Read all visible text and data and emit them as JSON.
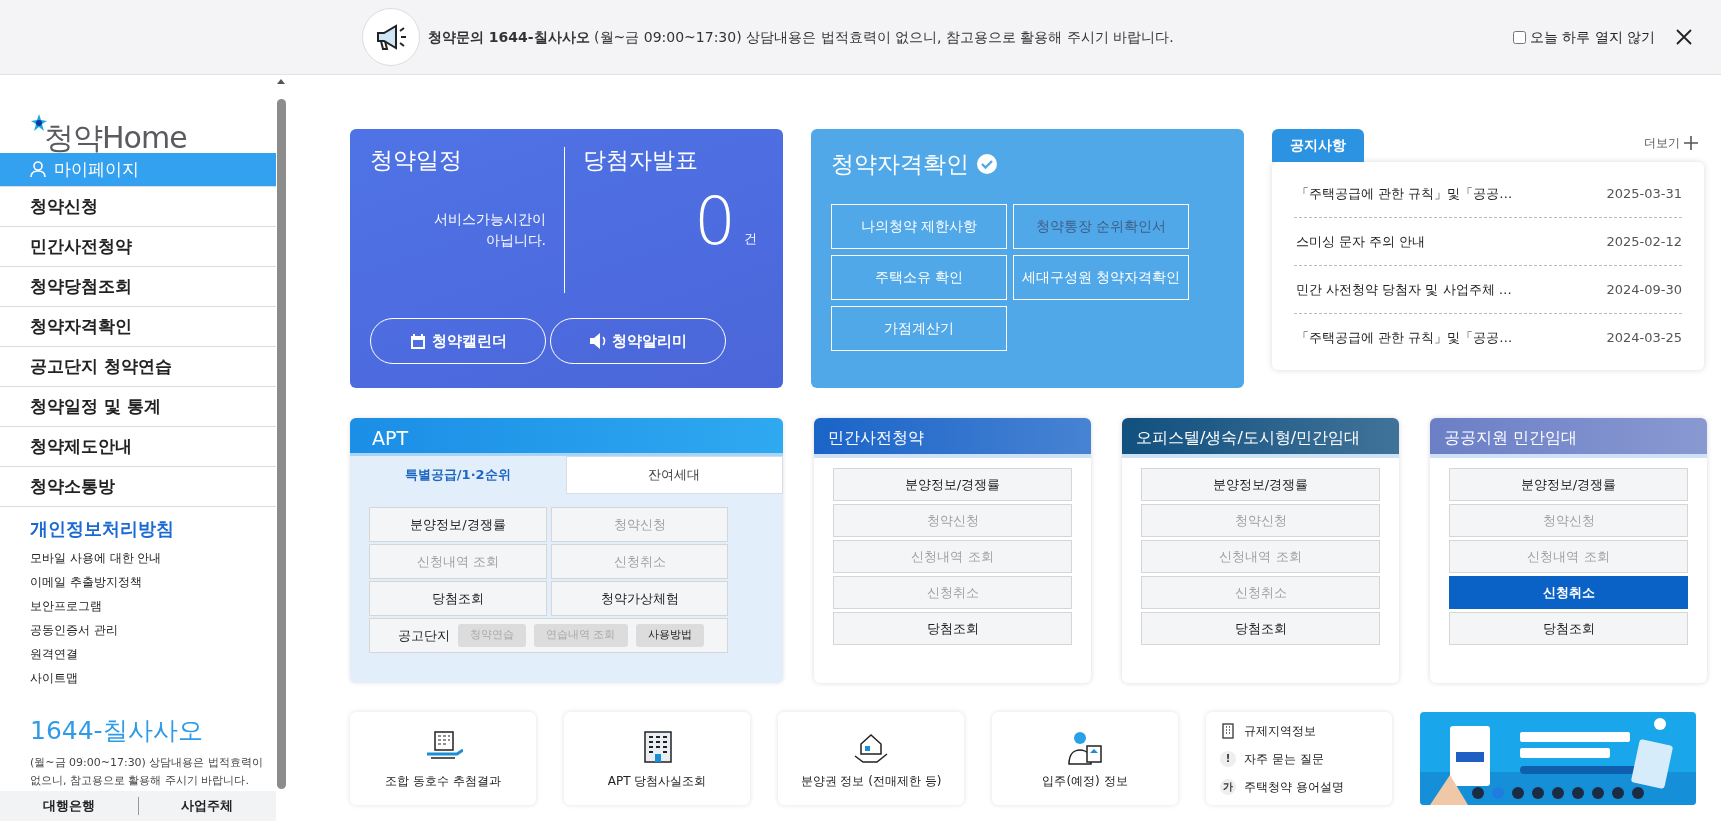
{
  "top_notice": {
    "text": "**청약문의 1644-칠사사오** (월~금 09:00~17:30) 상담내용은 법적효력이 없으니, 참고용으로 활용해 주시기 바랍니다.",
    "dismiss_label": "오늘 하루 열지 않기",
    "dismiss_checked": false
  },
  "sidebar": {
    "logo": "청약Home",
    "menu": [
      {
        "label": "마이페이지",
        "selected": true
      },
      {
        "label": "청약신청",
        "selected": false
      },
      {
        "label": "민간사전청약",
        "selected": false
      },
      {
        "label": "청약당첨조회",
        "selected": false
      },
      {
        "label": "청약자격확인",
        "selected": false
      },
      {
        "label": "공고단지 청약연습",
        "selected": false
      },
      {
        "label": "청약일정 및 통계",
        "selected": false
      },
      {
        "label": "청약제도안내",
        "selected": false
      },
      {
        "label": "청약소통방",
        "selected": false
      }
    ],
    "policy_title": "개인정보처리방침",
    "links": [
      "모바일 사용에 대한 안내",
      "이메일 추출방지정책",
      "보안프로그램",
      "공동인증서 관리",
      "원격연결",
      "사이트맵"
    ],
    "phone": "1644-칠사사오",
    "phone_note": "(월~금 09:00~17:30) 상담내용은 법적효력이 없으니, 참고용으로 활용해 주시기 바랍니다.",
    "footer_tabs": [
      "대행은행",
      "사업주체"
    ]
  },
  "schedule_card": {
    "title": "청약일정",
    "message": "서비스가능시간이 아닙니다.",
    "winner_title": "당첨자발표",
    "count": "0",
    "unit": "건",
    "buttons": [
      {
        "label": "청약캘린더",
        "kind": "calendar"
      },
      {
        "label": "청약알리미",
        "kind": "speaker"
      }
    ]
  },
  "eligibility_card": {
    "title": "청약자격확인",
    "buttons": [
      {
        "label": "나의청약 제한사항",
        "disabled": false
      },
      {
        "label": "청약통장 순위확인서",
        "disabled": true
      },
      {
        "label": "주택소유 확인",
        "disabled": false
      },
      {
        "label": "세대구성원 청약자격확인",
        "disabled": false
      },
      {
        "label": "가점계산기",
        "disabled": false
      }
    ]
  },
  "notices": {
    "title": "공지사항",
    "more": "더보기",
    "items": [
      {
        "title": "「주택공급에 관한 규칙」및「공공…",
        "date": "2025-03-31"
      },
      {
        "title": "스미싱 문자 주의 안내",
        "date": "2025-02-12"
      },
      {
        "title": "민간 사전청약 당첨자 및 사업주체 …",
        "date": "2024-09-30"
      },
      {
        "title": "「주택공급에 관한 규칙」및「공공…",
        "date": "2024-03-25"
      }
    ]
  },
  "apt": {
    "title": "APT",
    "tabs": [
      {
        "label": "특별공급/1·2순위",
        "selected": true
      },
      {
        "label": "잔여세대",
        "selected": false
      }
    ],
    "buttons": [
      {
        "label": "분양정보/경쟁률",
        "disabled": false
      },
      {
        "label": "청약신청",
        "disabled": true
      },
      {
        "label": "신청내역 조회",
        "disabled": true
      },
      {
        "label": "신청취소",
        "disabled": true
      },
      {
        "label": "당첨조회",
        "disabled": false
      },
      {
        "label": "청약가상체험",
        "disabled": false
      }
    ],
    "practice_label": "공고단지",
    "practice_buttons": [
      {
        "label": "청약연습",
        "disabled": true
      },
      {
        "label": "연습내역 조회",
        "disabled": true
      },
      {
        "label": "사용방법",
        "disabled": false
      }
    ]
  },
  "boxes": [
    {
      "title": "민간사전청약",
      "color": "#1a64c8",
      "buttons": [
        {
          "label": "분양정보/경쟁률",
          "disabled": false,
          "selected": false
        },
        {
          "label": "청약신청",
          "disabled": true,
          "selected": false
        },
        {
          "label": "신청내역 조회",
          "disabled": true,
          "selected": false
        },
        {
          "label": "신청취소",
          "disabled": true,
          "selected": false
        },
        {
          "label": "당첨조회",
          "disabled": false,
          "selected": false
        }
      ]
    },
    {
      "title": "오피스텔/생숙/도시형/민간임대",
      "color": "#11507f",
      "buttons": [
        {
          "label": "분양정보/경쟁률",
          "disabled": false,
          "selected": false
        },
        {
          "label": "청약신청",
          "disabled": true,
          "selected": false
        },
        {
          "label": "신청내역 조회",
          "disabled": true,
          "selected": false
        },
        {
          "label": "신청취소",
          "disabled": true,
          "selected": false
        },
        {
          "label": "당첨조회",
          "disabled": false,
          "selected": false
        }
      ]
    },
    {
      "title": "공공지원 민간임대",
      "color": "#6b7fc6",
      "buttons": [
        {
          "label": "분양정보/경쟁률",
          "disabled": false,
          "selected": false
        },
        {
          "label": "청약신청",
          "disabled": true,
          "selected": false
        },
        {
          "label": "신청내역 조회",
          "disabled": true,
          "selected": false
        },
        {
          "label": "신청취소",
          "disabled": false,
          "selected": true
        },
        {
          "label": "당첨조회",
          "disabled": false,
          "selected": false
        }
      ]
    }
  ],
  "quick_links": [
    {
      "label": "조합 동호수 추첨결과",
      "kind": "building-hand"
    },
    {
      "label": "APT 당첨사실조회",
      "kind": "apartment"
    },
    {
      "label": "분양권 정보 (전매제한 등)",
      "kind": "house-hand"
    },
    {
      "label": "입주(예정) 정보",
      "kind": "person-document"
    }
  ],
  "info_links": [
    {
      "label": "규제지역정보",
      "kind": "building"
    },
    {
      "label": "자주 묻는 질문",
      "kind": "glyph",
      "glyph": "!"
    },
    {
      "label": "주택청약 용어설명",
      "kind": "glyph",
      "glyph": "가"
    }
  ],
  "banner": {
    "kind": "picture",
    "slides": [
      {
        "selected": false
      },
      {
        "selected": true
      },
      {
        "selected": false
      },
      {
        "selected": false
      },
      {
        "selected": false
      },
      {
        "selected": false
      },
      {
        "selected": false
      },
      {
        "selected": false
      },
      {
        "selected": false
      }
    ]
  }
}
